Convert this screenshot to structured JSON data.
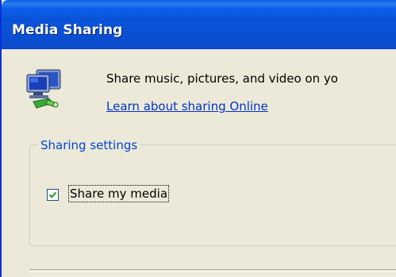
{
  "window": {
    "title": "Media Sharing"
  },
  "header": {
    "description": "Share music, pictures, and video on yo",
    "learn_link": "Learn about sharing Online",
    "icon": "network-computer-icon"
  },
  "sharing_settings": {
    "group_title": "Sharing settings",
    "share_my_media": {
      "label": "Share my media",
      "checked": true
    }
  },
  "colors": {
    "titlebar": "#0a53d8",
    "window_bg": "#ece9d8",
    "link": "#0033cc",
    "group_title": "#0046d5",
    "checkmark": "#21a121"
  }
}
